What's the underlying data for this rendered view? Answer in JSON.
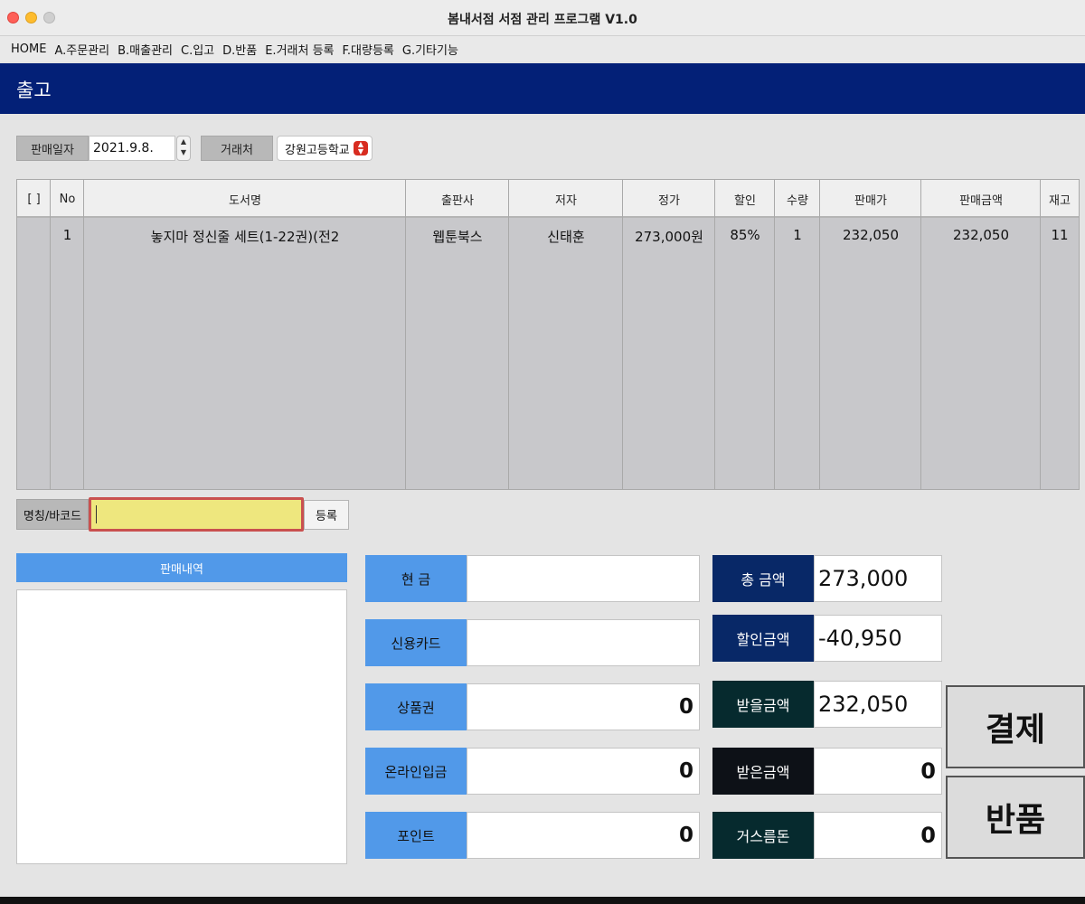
{
  "window": {
    "title": "봄내서점 서점 관리 프로그램 V1.0"
  },
  "menu": [
    "HOME",
    "A.주문관리",
    "B.매출관리",
    "C.입고",
    "D.반품",
    "E.거래처 등록",
    "F.대량등록",
    "G.기타기능"
  ],
  "section_title": "출고",
  "filters": {
    "date_label": "판매일자",
    "date_value": "2021.9.8.",
    "client_label": "거래처",
    "client_value": "강원고등학교"
  },
  "table": {
    "columns": [
      "[ ]",
      "No",
      "도서명",
      "출판사",
      "저자",
      "정가",
      "할인",
      "수량",
      "판매가",
      "판매금액",
      "재고"
    ],
    "rows": [
      {
        "no": "1",
        "title": "놓지마 정신줄 세트(1-22권)(전2",
        "publisher": "웹툰북스",
        "author": "신태훈",
        "list_price": "273,000원",
        "discount": "85%",
        "qty": "1",
        "sale_price": "232,050",
        "sale_amount": "232,050",
        "stock": "11"
      }
    ]
  },
  "barcode": {
    "label": "명칭/바코드",
    "value": "",
    "register_label": "등록"
  },
  "history": {
    "label": "판매내역"
  },
  "payments": [
    {
      "label": "현 금",
      "value": ""
    },
    {
      "label": "신용카드",
      "value": ""
    },
    {
      "label": "상품권",
      "value": "0"
    },
    {
      "label": "온라인입금",
      "value": "0"
    },
    {
      "label": "포인트",
      "value": "0"
    }
  ],
  "summary": [
    {
      "label": "총 금액",
      "value": "273,000",
      "color": "#082867"
    },
    {
      "label": "할인금액",
      "value": "-40,950",
      "color": "#082867"
    },
    {
      "label": "받을금액",
      "value": "232,050",
      "color": "#062a2e"
    },
    {
      "label": "받은금액",
      "value": "0",
      "color": "#0d1117"
    },
    {
      "label": "거스름돈",
      "value": "0",
      "color": "#062a2e"
    }
  ],
  "actions": {
    "pay_label": "결제",
    "return_label": "반품"
  }
}
